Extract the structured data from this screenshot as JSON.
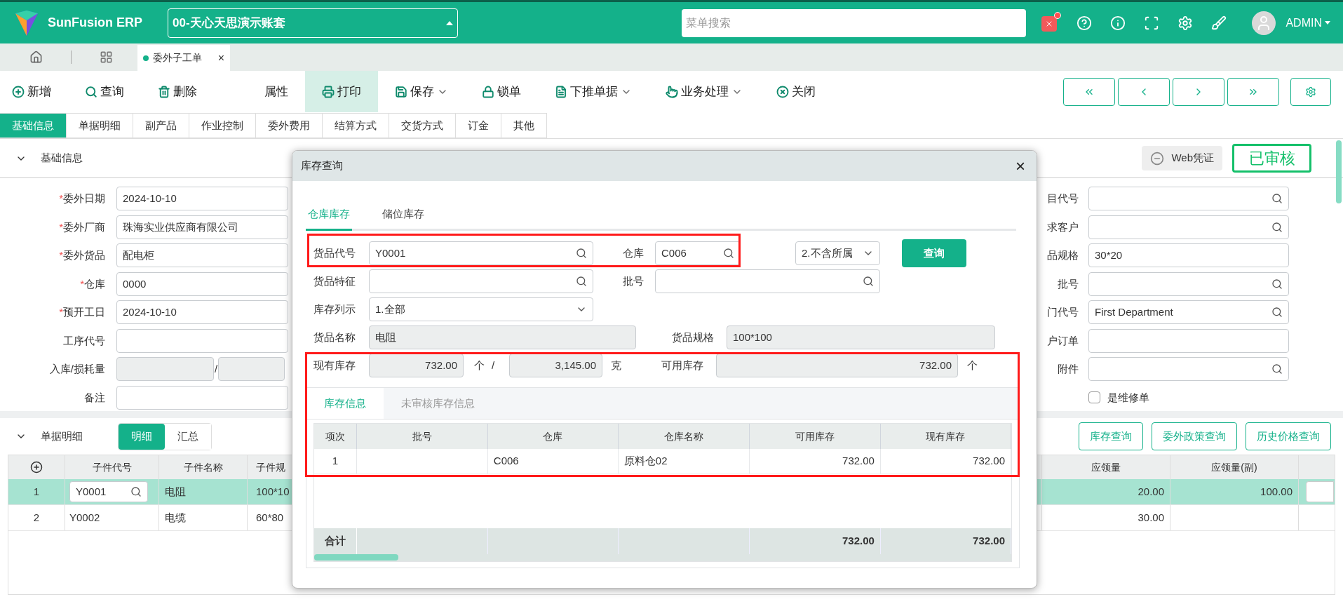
{
  "header": {
    "brand": "SunFusion ERP",
    "account": "00-天心天思演示账套",
    "search": {
      "placeholder": "菜单搜索"
    },
    "notification_dot": true,
    "user": "ADMIN"
  },
  "page_tabs": [
    {
      "label": "委外子工单",
      "selected": true,
      "close": "×"
    }
  ],
  "toolbar": [
    {
      "label": "新增",
      "menu": false,
      "selected": false
    },
    {
      "label": "查询",
      "menu": false,
      "selected": false
    },
    {
      "label": "删除",
      "menu": false,
      "selected": false
    },
    {
      "label": "属性",
      "menu": false,
      "selected": false
    },
    {
      "label": "打印",
      "menu": false,
      "selected": true
    },
    {
      "label": "保存",
      "menu": true,
      "selected": false
    },
    {
      "label": "锁单",
      "menu": false,
      "selected": false
    },
    {
      "label": "下推单据",
      "menu": true,
      "selected": false
    },
    {
      "label": "业务处理",
      "menu": true,
      "selected": false
    },
    {
      "label": "关闭",
      "menu": false,
      "selected": false
    }
  ],
  "form_tabs": [
    {
      "label": "基础信息",
      "selected": true
    },
    {
      "label": "单据明细",
      "selected": false
    },
    {
      "label": "副产品",
      "selected": false
    },
    {
      "label": "作业控制",
      "selected": false
    },
    {
      "label": "委外费用",
      "selected": false
    },
    {
      "label": "结算方式",
      "selected": false
    },
    {
      "label": "交货方式",
      "selected": false
    },
    {
      "label": "订金",
      "selected": false
    },
    {
      "label": "其他",
      "selected": false
    }
  ],
  "basic_section": {
    "title": "基础信息",
    "expanded": true,
    "voucher_button": "Web凭证",
    "status_stamp": "已审核"
  },
  "left_form": [
    {
      "required_mark": "*",
      "label": "委外日期",
      "kind": "text",
      "value": "2024-10-10"
    },
    {
      "required_mark": "*",
      "label": "委外厂商",
      "kind": "text",
      "value": "珠海实业供应商有限公司"
    },
    {
      "required_mark": "*",
      "label": "委外货品",
      "kind": "text",
      "value": "配电柜"
    },
    {
      "required_mark": "*",
      "label": "仓库",
      "kind": "text",
      "value": "0000"
    },
    {
      "required_mark": "*",
      "label": "预开工日",
      "kind": "text",
      "value": "2024-10-10"
    },
    {
      "label": "工序代号",
      "kind": "text"
    },
    {
      "label": "入库/损耗量",
      "kind": "pair",
      "separator": "/"
    },
    {
      "label": "备注",
      "kind": "text"
    }
  ],
  "right_form": [
    {
      "label": "目代号",
      "kind": "search"
    },
    {
      "label": "求客户",
      "kind": "search"
    },
    {
      "label": "品规格",
      "kind": "text",
      "value": "30*20"
    },
    {
      "label": "批号",
      "kind": "search"
    },
    {
      "label": "门代号",
      "kind": "search",
      "value": "First Department"
    },
    {
      "label": "户订单",
      "kind": "text"
    },
    {
      "label": "附件",
      "kind": "search"
    },
    {
      "label": "是维修单",
      "kind": "checkbox",
      "checked": false
    }
  ],
  "detail_section": {
    "title": "单据明细",
    "expanded": true,
    "views": [
      {
        "label": "明细",
        "selected": true
      },
      {
        "label": "汇总",
        "selected": false
      }
    ],
    "buttons": [
      "库存查询",
      "委外政策查询",
      "历史价格查询"
    ]
  },
  "detail_table": {
    "columns": [
      "子件代号",
      "子件名称",
      "子件规",
      "应领量",
      "应领量(副)"
    ],
    "rows": [
      {
        "selected": true,
        "no": "1",
        "code": "Y0001",
        "name": "电阻",
        "spec": "100*10",
        "qty": "20.00",
        "qty2": "100.00"
      },
      {
        "selected": false,
        "no": "2",
        "code": "Y0002",
        "name": "电缆",
        "spec": "60*80",
        "qty": "30.00"
      }
    ]
  },
  "dialog": {
    "title": "库存查询",
    "close": "×",
    "tabs": [
      {
        "label": "仓库库存",
        "selected": true
      },
      {
        "label": "储位库存",
        "selected": false
      }
    ],
    "item_code": {
      "label": "货品代号",
      "value": "Y0001"
    },
    "warehouse": {
      "label": "仓库",
      "value": "C006"
    },
    "scope_select": "2.不含所属",
    "query_button": "查询",
    "feature": {
      "label": "货品特征"
    },
    "batch": {
      "label": "批号"
    },
    "list_mode": {
      "label": "库存列示",
      "value": "1.全部"
    },
    "item_name": {
      "label": "货品名称",
      "value": "电阻"
    },
    "item_spec": {
      "label": "货品规格",
      "value": "100*100"
    },
    "stock": {
      "label": "现有库存",
      "value": "732.00",
      "unit": "个",
      "separator": "/",
      "value2": "3,145.00",
      "unit2": "克"
    },
    "available": {
      "label": "可用库存",
      "value": "732.00",
      "unit": "个"
    },
    "inner_tabs": [
      {
        "label": "库存信息",
        "selected": true
      },
      {
        "label": "未审核库存信息",
        "selected": false
      }
    ],
    "grid": {
      "columns": [
        "项次",
        "批号",
        "仓库",
        "仓库名称",
        "可用库存",
        "现有库存"
      ],
      "rows": [
        [
          "1",
          null,
          "C006",
          "原料仓02",
          "732.00",
          "732.00"
        ]
      ],
      "total": {
        "label": "合计",
        "available": "732.00",
        "on_hand": "732.00"
      }
    }
  }
}
